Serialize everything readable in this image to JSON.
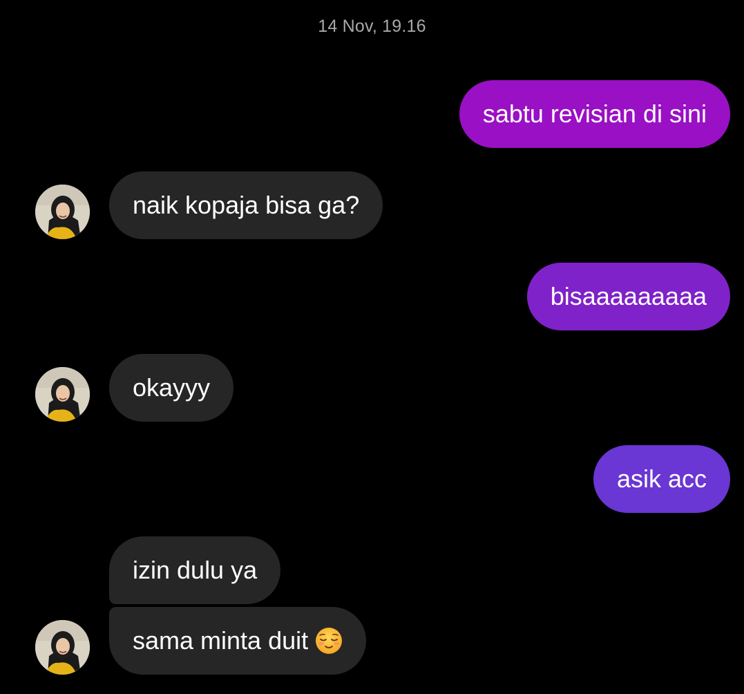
{
  "conversation": {
    "timestamp": "14 Nov, 19.16",
    "messages": [
      {
        "id": "m1",
        "direction": "outgoing",
        "text": "sabtu revisian di sini",
        "color": "#9a10c4"
      },
      {
        "id": "m2",
        "direction": "incoming",
        "text": "naik kopaja bisa ga?"
      },
      {
        "id": "m3",
        "direction": "outgoing",
        "text": "bisaaaaaaaaa",
        "color": "#7f22c9"
      },
      {
        "id": "m4",
        "direction": "incoming",
        "text": "okayyy"
      },
      {
        "id": "m5",
        "direction": "outgoing",
        "text": "asik acc",
        "color": "#6a36d4"
      },
      {
        "id": "m6",
        "direction": "incoming",
        "text": "izin dulu ya"
      },
      {
        "id": "m7",
        "direction": "incoming",
        "text": "sama minta duit",
        "emoji": "relieved-face-icon"
      }
    ]
  },
  "colors": {
    "background": "#000000",
    "incoming_bubble": "#262626",
    "timestamp_text": "#a8a8a8"
  }
}
